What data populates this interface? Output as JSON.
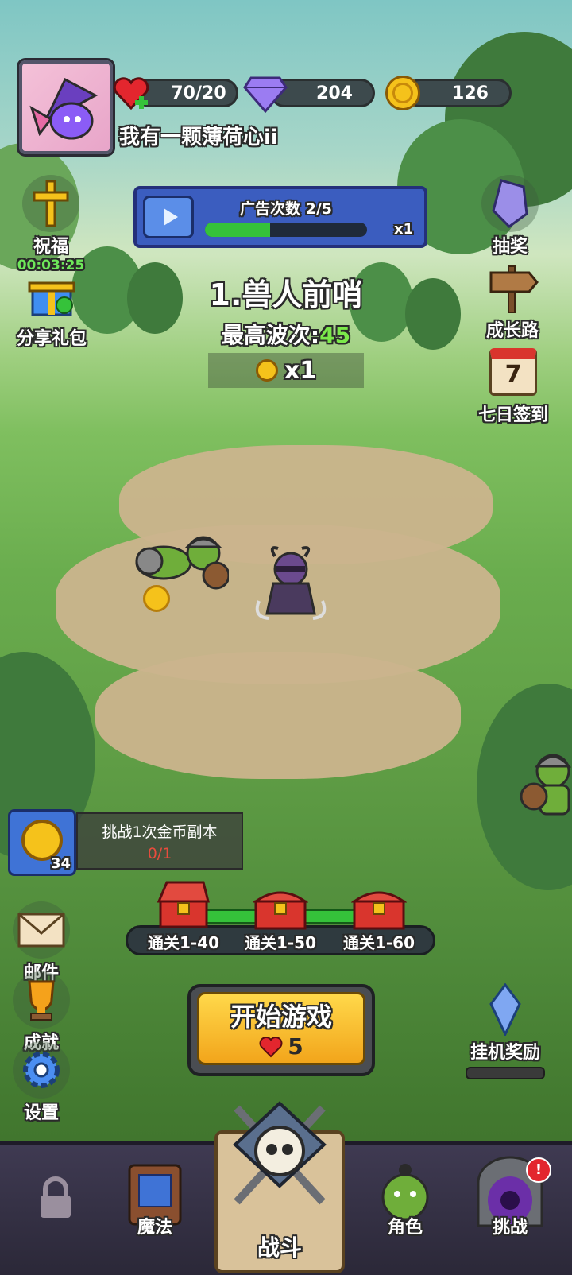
{
  "player": {
    "name": "我有一颗薄荷心ii",
    "hearts": "70/20",
    "gems": "204",
    "coins": "126"
  },
  "left_menu": {
    "bless_label": "祝福",
    "bless_timer": "00:03:25",
    "share_label": "分享礼包",
    "mail_label": "邮件",
    "achievement_label": "成就",
    "settings_label": "设置"
  },
  "right_menu": {
    "lottery_label": "抽奖",
    "growth_label": "成长路",
    "signin_label": "七日签到",
    "signin_day": "7",
    "idle_reward_label": "挂机奖励"
  },
  "ad": {
    "label": "广告次数 2/5",
    "progress": 0.4,
    "multiplier": "x1"
  },
  "stage": {
    "title": "1.兽人前哨",
    "best_wave_label": "最高波次:",
    "best_wave_value": "45",
    "coin_multiplier": "x1"
  },
  "task": {
    "label": "挑战1次金币副本",
    "progress": "0/1",
    "count": "34"
  },
  "chests": [
    {
      "label": "通关1-40"
    },
    {
      "label": "通关1-50"
    },
    {
      "label": "通关1-60"
    }
  ],
  "start": {
    "label": "开始游戏",
    "cost": "5"
  },
  "nav": {
    "magic": "魔法",
    "battle": "战斗",
    "role": "角色",
    "challenge": "挑战"
  },
  "colors": {
    "accent_green": "#7be84a",
    "timer_green": "#6ee85a",
    "gold": "#f5c21b",
    "red_progress": "#e84c3d"
  }
}
